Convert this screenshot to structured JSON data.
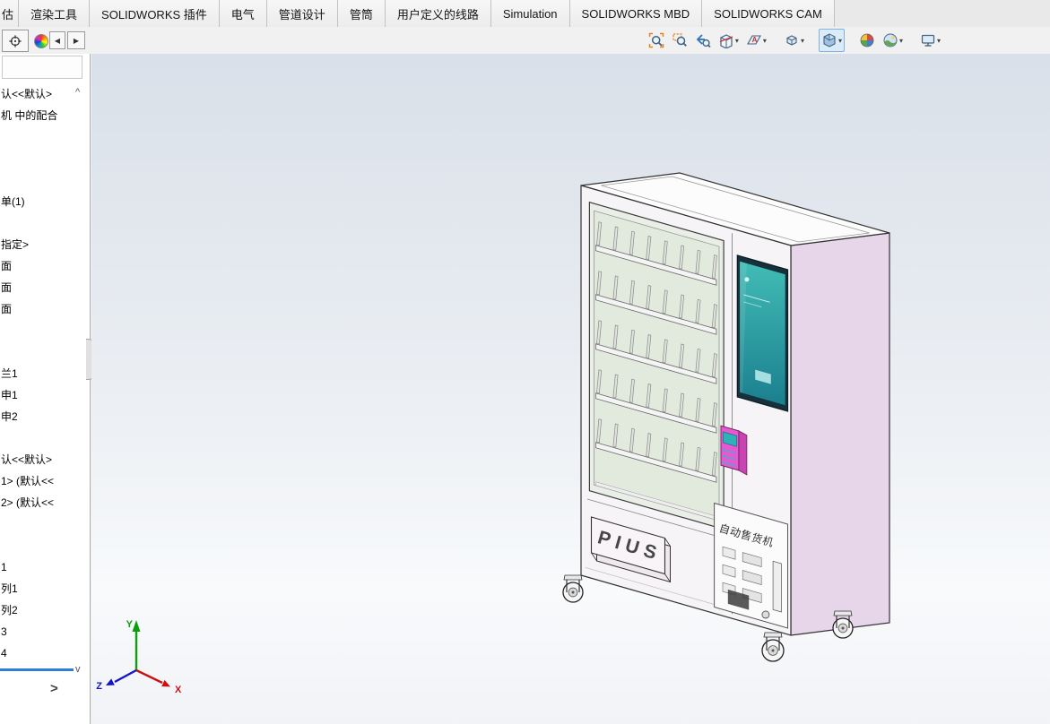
{
  "app": {
    "name": "SOLIDWORKS"
  },
  "menu_tabs": [
    "估",
    "渲染工具",
    "SOLIDWORKS 插件",
    "电气",
    "管道设计",
    "管筒",
    "用户定义的线路",
    "Simulation",
    "SOLIDWORKS MBD",
    "SOLIDWORKS CAM"
  ],
  "left_toolbar": {
    "back_glyph": "◀",
    "forward_glyph": "▶"
  },
  "view_toolbar": {
    "items": [
      {
        "name": "zoom-to-fit-icon"
      },
      {
        "name": "zoom-to-area-icon"
      },
      {
        "name": "previous-view-icon"
      },
      {
        "name": "section-view-icon",
        "dropdown": true
      },
      {
        "name": "annotation-views-icon",
        "dropdown": true,
        "group_end": true
      },
      {
        "name": "view-orientation-icon",
        "dropdown": true,
        "group_end": true
      },
      {
        "name": "display-style-icon",
        "dropdown": true,
        "active": true,
        "group_end": true
      },
      {
        "name": "edit-appearance-icon"
      },
      {
        "name": "apply-scene-icon",
        "dropdown": true,
        "group_end": true
      },
      {
        "name": "view-settings-icon",
        "dropdown": true
      }
    ]
  },
  "feature_tree": {
    "scroll_up_glyph": "^",
    "scroll_down_glyph": "v",
    "expand_glyph": ">",
    "rollback_color": "#2f7fd6",
    "items": [
      {
        "label": "认<<默认>",
        "row": 0
      },
      {
        "label": "机 中的配合",
        "row": 1
      },
      {
        "label": "单(1)",
        "row": 5
      },
      {
        "label": "指定>",
        "row": 7
      },
      {
        "label": "面",
        "row": 8
      },
      {
        "label": "面",
        "row": 9
      },
      {
        "label": "面",
        "row": 10
      },
      {
        "label": "兰1",
        "row": 13
      },
      {
        "label": "申1",
        "row": 14
      },
      {
        "label": "申2",
        "row": 15
      },
      {
        "label": "认<<默认>",
        "row": 17
      },
      {
        "label": "1> (默认<<",
        "row": 18
      },
      {
        "label": "2> (默认<<",
        "row": 19
      },
      {
        "label": "1",
        "row": 22
      },
      {
        "label": "列1",
        "row": 23
      },
      {
        "label": "列2",
        "row": 24
      },
      {
        "label": "3",
        "row": 25
      },
      {
        "label": "4",
        "row": 26
      }
    ]
  },
  "viewport": {
    "gradient_top": "#d9e0e9",
    "gradient_mid": "#edf0f4",
    "gradient_bottom": "#f1f3f6"
  },
  "model": {
    "sign_text": "PIUS",
    "panel_text": "自动售货机",
    "colors": {
      "side": "#e7d5ea",
      "front": "#f6f4f7",
      "top": "#fcfcfd",
      "outline": "#333333",
      "screen_top": "#41bcb6",
      "screen_bottom": "#1b7f8e",
      "card_reader": "#ea55d4",
      "glass": "#e9efe6"
    }
  },
  "triad": {
    "labels": {
      "x": "X",
      "y": "Y",
      "z": "Z"
    },
    "colors": {
      "x": "#cc1111",
      "y": "#0f9d0f",
      "z": "#1414cc"
    }
  }
}
